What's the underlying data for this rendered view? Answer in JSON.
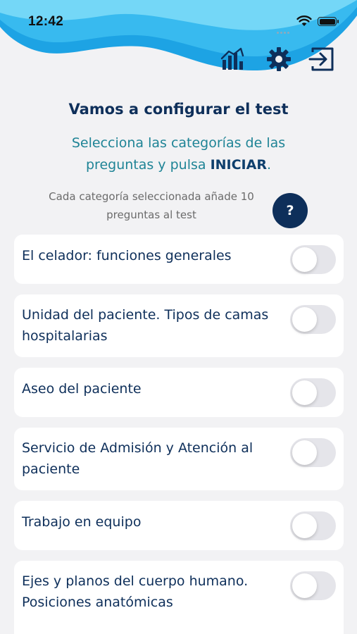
{
  "status": {
    "time": "12:42"
  },
  "toolbar": {
    "icons": [
      "stats-icon",
      "gear-icon",
      "logout-icon"
    ],
    "color": "#0e2f5a"
  },
  "config": {
    "title": "Vamos a configurar el test",
    "subtitle_part1": "Selecciona las categorías de las preguntas y pulsa ",
    "subtitle_strong": "INICIAR",
    "subtitle_part2": ".",
    "info": "Cada categoría seleccionada añade 10 preguntas al test",
    "help_label": "?"
  },
  "categories": [
    {
      "label": "El celador: funciones generales",
      "selected": false
    },
    {
      "label": "Unidad del paciente. Tipos de camas hospitalarias",
      "selected": false
    },
    {
      "label": "Aseo del paciente",
      "selected": false
    },
    {
      "label": "Servicio de Admisión y Atención al paciente",
      "selected": false
    },
    {
      "label": "Trabajo en equipo",
      "selected": false
    },
    {
      "label": "Ejes y planos del cuerpo humano. Posiciones anatómicas",
      "selected": false
    }
  ],
  "colors": {
    "accent": "#0e2f5a",
    "subtitle": "#1f8496",
    "wave_light": "#6fd3f5",
    "wave_dark": "#1da3e4",
    "background": "#f2f2f4",
    "toggle_off": "#e5e5ea"
  }
}
